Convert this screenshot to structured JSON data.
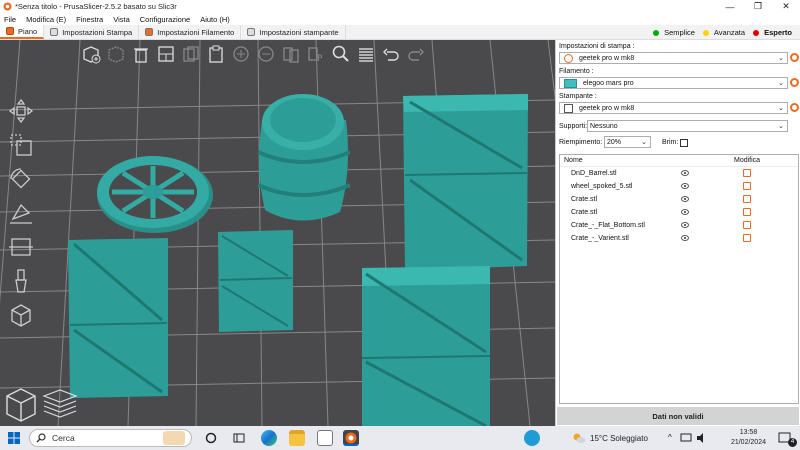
{
  "window": {
    "title": "*Senza titolo - PrusaSlicer-2.5.2 basato su Slic3r",
    "controls": [
      "—",
      "❐",
      "✕"
    ]
  },
  "menu": [
    "File",
    "Modifica (E)",
    "Finestra",
    "Vista",
    "Configurazione",
    "Aiuto (H)"
  ],
  "tabs": [
    {
      "label": "Piano",
      "active": true
    },
    {
      "label": "Impostazioni Stampa",
      "active": false
    },
    {
      "label": "Impostazioni Filamento",
      "active": false
    },
    {
      "label": "Impostazioni stampante",
      "active": false
    }
  ],
  "modes": [
    {
      "label": "Semplice",
      "color": "#00b000",
      "selected": false
    },
    {
      "label": "Avanzata",
      "color": "#ffd200",
      "selected": false
    },
    {
      "label": "Esperto",
      "color": "#e00000",
      "selected": true
    }
  ],
  "panel": {
    "print_settings_label": "Impostazioni di stampa :",
    "print_settings_value": "geetek pro w mk8",
    "filament_label": "Filamento :",
    "filament_value": "elegoo mars pro",
    "filament_color": "#3fbfbf",
    "printer_label": "Stampante :",
    "printer_value": "geetek pro w mk8",
    "supports_label": "Supporti:",
    "supports_value": "Nessuno",
    "infill_label": "Riempimento:",
    "infill_value": "20%",
    "brim_label": "Brim:",
    "brim_checked": false,
    "col_name": "Nome",
    "col_edit": "Modifica",
    "objects": [
      "DnD_Barrel.stl",
      "wheel_spoked_5.stl",
      "Crate.stl",
      "Crate.stl",
      "Crate_-_Flat_Bottom.stl",
      "Crate_-_Varient.stl"
    ],
    "slice_button": "Dati non validi"
  },
  "icons": {
    "toolbar": [
      "add-icon",
      "delete-icon",
      "delete-all-icon",
      "arrange-icon",
      "copy-icon",
      "paste-icon",
      "add-instance-icon",
      "remove-instance-icon",
      "split-objects-icon",
      "split-parts-icon",
      "search-icon",
      "layers-icon",
      "undo-icon",
      "redo-icon"
    ],
    "sidetools": [
      "move-icon",
      "scale-icon",
      "rotate-icon",
      "place-on-face-icon",
      "cut-icon",
      "paint-supports-icon",
      "seam-paint-icon"
    ]
  },
  "colors": {
    "accent": "#ed6b21",
    "model": "#2d9e97",
    "bed": "#4a4a4d"
  },
  "taskbar": {
    "search_placeholder": "Cerca",
    "weather": "15°C Soleggiato",
    "time": "13:58",
    "date": "21/02/2024",
    "notifications": "4"
  }
}
